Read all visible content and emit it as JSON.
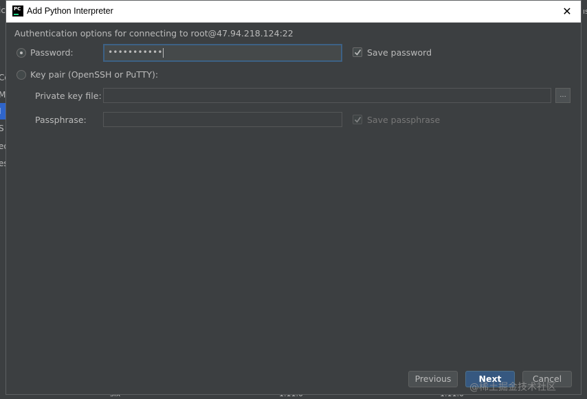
{
  "window": {
    "title": "Add Python Interpreter",
    "app_icon_text": "PC",
    "close_glyph": "✕"
  },
  "auth": {
    "title": "Authentication options for connecting to root@47.94.218.124:22",
    "password": {
      "label": "Password:",
      "selected": true,
      "value": "•••••••••••",
      "save_label": "Save password",
      "save_checked": true
    },
    "keypair": {
      "label": "Key pair (OpenSSH or PuTTY):",
      "selected": false,
      "private_key_label": "Private key file:",
      "private_key_value": "",
      "browse_label": "...",
      "passphrase_label": "Passphrase:",
      "passphrase_value": "",
      "save_passphrase_label": "Save passphrase",
      "save_passphrase_checked": true
    }
  },
  "buttons": {
    "previous": "Previous",
    "next": "Next",
    "cancel": "Cancel"
  },
  "background": {
    "left_fragments": [
      "ic",
      "Co",
      "Mi",
      "I",
      "S",
      "ed",
      "es"
    ],
    "bottom_row": [
      "six",
      "1.11.0",
      "1.11.0"
    ],
    "right_tab": "ıs"
  },
  "watermark": "@稀土掘金技术社区",
  "colors": {
    "dialog_bg": "#3c3f41",
    "text": "#bbbbbb",
    "focus_border": "#3d6185",
    "next_button": "#365880",
    "selection": "#2f65ca"
  }
}
